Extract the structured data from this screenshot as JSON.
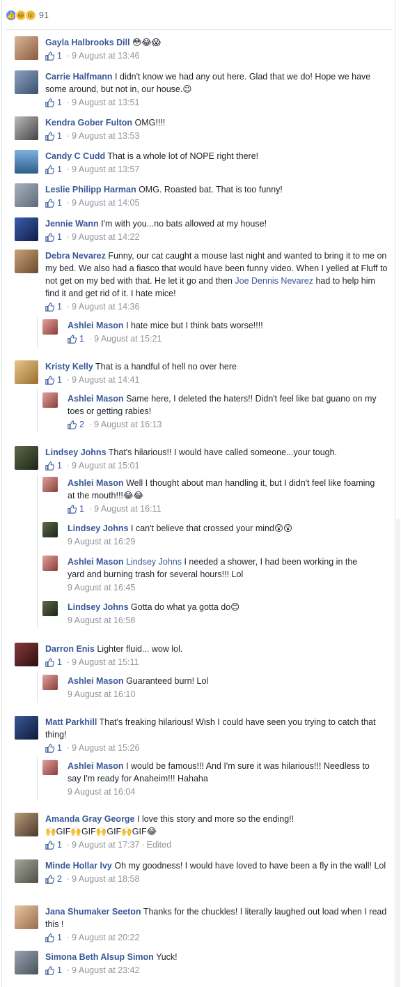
{
  "reactions": {
    "icons": [
      "like-icon",
      "haha-icon",
      "wow-icon"
    ],
    "count": "91"
  },
  "colors": {
    "link": "#385898",
    "meta": "#90949c",
    "like": "#5890ff"
  },
  "comments": [
    {
      "author": "Gayla Halbrooks Dill",
      "text": "😳😂😱",
      "likes": "1",
      "time": "9 August at 13:46"
    },
    {
      "author": "Carrie Halfmann",
      "text": "I didn't know we had any out here. Glad that we do! Hope we have some around, but not in, our house.😉",
      "likes": "1",
      "time": "9 August at 13:51"
    },
    {
      "author": "Kendra Gober Fulton",
      "text": "OMG!!!!",
      "likes": "1",
      "time": "9 August at 13:53"
    },
    {
      "author": "Candy C Cudd",
      "text": "That is a whole lot of NOPE right there!",
      "likes": "1",
      "time": "9 August at 13:57"
    },
    {
      "author": "Leslie Philipp Harman",
      "text": "OMG. Roasted bat. That is too funny!",
      "likes": "1",
      "time": "9 August at 14:05"
    },
    {
      "author": "Jennie Wann",
      "text": "I'm with you...no bats allowed at my house!",
      "likes": "1",
      "time": "9 August at 14:22"
    },
    {
      "author": "Debra Nevarez",
      "text": "Funny, our cat caught a mouse last night and wanted to bring it to me on my bed. We also had a fiasco that would have been funny video. When I yelled at Fluff to not get on my bed with that. He let it go and then",
      "mention": "Joe Dennis Nevarez",
      "text2": "had to help him find it and get rid of it. I hate mice!",
      "likes": "1",
      "time": "9 August at 14:36",
      "replies": [
        {
          "author": "Ashlei Mason",
          "text": "I hate mice but I think bats worse!!!!",
          "likes": "1",
          "time": "9 August at 15:21"
        }
      ]
    },
    {
      "author": "Kristy Kelly",
      "text": "That is a handful of hell no over here",
      "likes": "1",
      "time": "9 August at 14:41",
      "replies": [
        {
          "author": "Ashlei Mason",
          "text": "Same here, I deleted the haters!! Didn't feel like bat guano on my toes or getting rabies!",
          "likes": "2",
          "time": "9 August at 16:13"
        }
      ]
    },
    {
      "author": "Lindsey Johns",
      "text": "That's hilarious!! I would have called someone...your tough.",
      "likes": "1",
      "time": "9 August at 15:01",
      "replies": [
        {
          "author": "Ashlei Mason",
          "text": "Well I thought about man handling it, but I didn't feel like foaming at the mouth!!!😂😂",
          "likes": "1",
          "time": "9 August at 16:11"
        },
        {
          "author": "Lindsey Johns",
          "text": "I can't believe that crossed your mind😲😲",
          "time": "9 August at 16:29"
        },
        {
          "author": "Ashlei Mason",
          "mention": "Lindsey Johns",
          "text": "I needed a shower, I had been working in the yard and burning trash for several hours!!! Lol",
          "time": "9 August at 16:45"
        },
        {
          "author": "Lindsey Johns",
          "text": "Gotta do what ya gotta do😊",
          "time": "9 August at 16:58"
        }
      ]
    },
    {
      "author": "Darron Enis",
      "text": "Lighter fluid... wow lol.",
      "likes": "1",
      "time": "9 August at 15:11",
      "replies": [
        {
          "author": "Ashlei Mason",
          "text": "Guaranteed burn! Lol",
          "time": "9 August at 16:10"
        }
      ]
    },
    {
      "author": "Matt Parkhill",
      "text": "That's freaking hilarious! Wish I could have seen you trying to catch that thing!",
      "likes": "1",
      "time": "9 August at 15:26",
      "replies": [
        {
          "author": "Ashlei Mason",
          "text": "I would be famous!!! And I'm sure it was hilarious!!! Needless to say I'm ready for Anaheim!!! Hahaha",
          "time": "9 August at 16:04"
        }
      ]
    },
    {
      "author": "Amanda Gray George",
      "text": "I love this story and more so the ending!!",
      "text2": "🙌GIF🙌GIF🙌GIF🙌GIF😂",
      "likes": "1",
      "time": "9 August at 17:37",
      "edited": "Edited"
    },
    {
      "author": "Minde Hollar Ivy",
      "text": "Oh my goodness! I would have loved to have been a fly in the wall! Lol",
      "likes": "2",
      "time": "9 August at 18:58"
    },
    {
      "author": "Jana Shumaker Seeton",
      "text": "Thanks for the chuckles! I literally laughed out load when I read this !",
      "likes": "1",
      "time": "9 August at 20:22"
    },
    {
      "author": "Simona Beth Alsup Simon",
      "text": "Yuck!",
      "likes": "1",
      "time": "9 August at 23:42"
    }
  ]
}
